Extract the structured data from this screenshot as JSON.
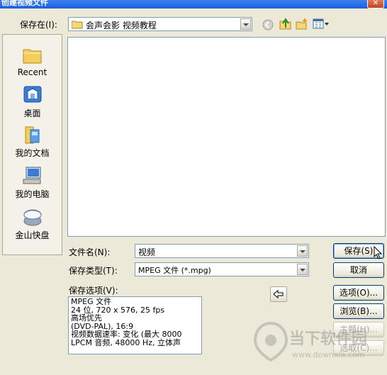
{
  "window": {
    "title": "创建视频文件",
    "close_label": "✕"
  },
  "lookin": {
    "label": "保存在(I):",
    "value": "会声会影 视频教程"
  },
  "toolbar": {
    "icons": [
      "back-icon",
      "up-folder-icon",
      "new-folder-icon",
      "view-menu-icon"
    ]
  },
  "places": [
    {
      "label": "Recent",
      "icon": "recent-folder-icon"
    },
    {
      "label": "桌面",
      "icon": "desktop-icon"
    },
    {
      "label": "我的文档",
      "icon": "my-documents-icon"
    },
    {
      "label": "我的电脑",
      "icon": "my-computer-icon"
    },
    {
      "label": "金山快盘",
      "icon": "kuaipan-drive-icon"
    }
  ],
  "filename": {
    "label": "文件名(N):",
    "value": "视频"
  },
  "filetype": {
    "label": "保存类型(T):",
    "value": "MPEG 文件 (*.mpg)"
  },
  "buttons": {
    "save": "保存(S)",
    "cancel": "取消",
    "options": "选项(O)...",
    "browse": "浏览(B)...",
    "theme": "主题(H)...",
    "pick": "选取(C)..."
  },
  "save_options": {
    "label": "保存选项(V):",
    "lines": [
      "MPEG 文件",
      "24 位, 720 x 576, 25 fps",
      "高场优先",
      "(DVD-PAL), 16:9",
      "视频数据速率: 变化 (最大 8000",
      "LPCM 音频, 48000 Hz, 立体声"
    ]
  },
  "watermark": {
    "brand": "当下软件园",
    "url": "www.downxia.com"
  },
  "colors": {
    "title_bar": "#1c5fd8",
    "dialog_bg": "#ece9d8",
    "field_border": "#7f9db9"
  }
}
